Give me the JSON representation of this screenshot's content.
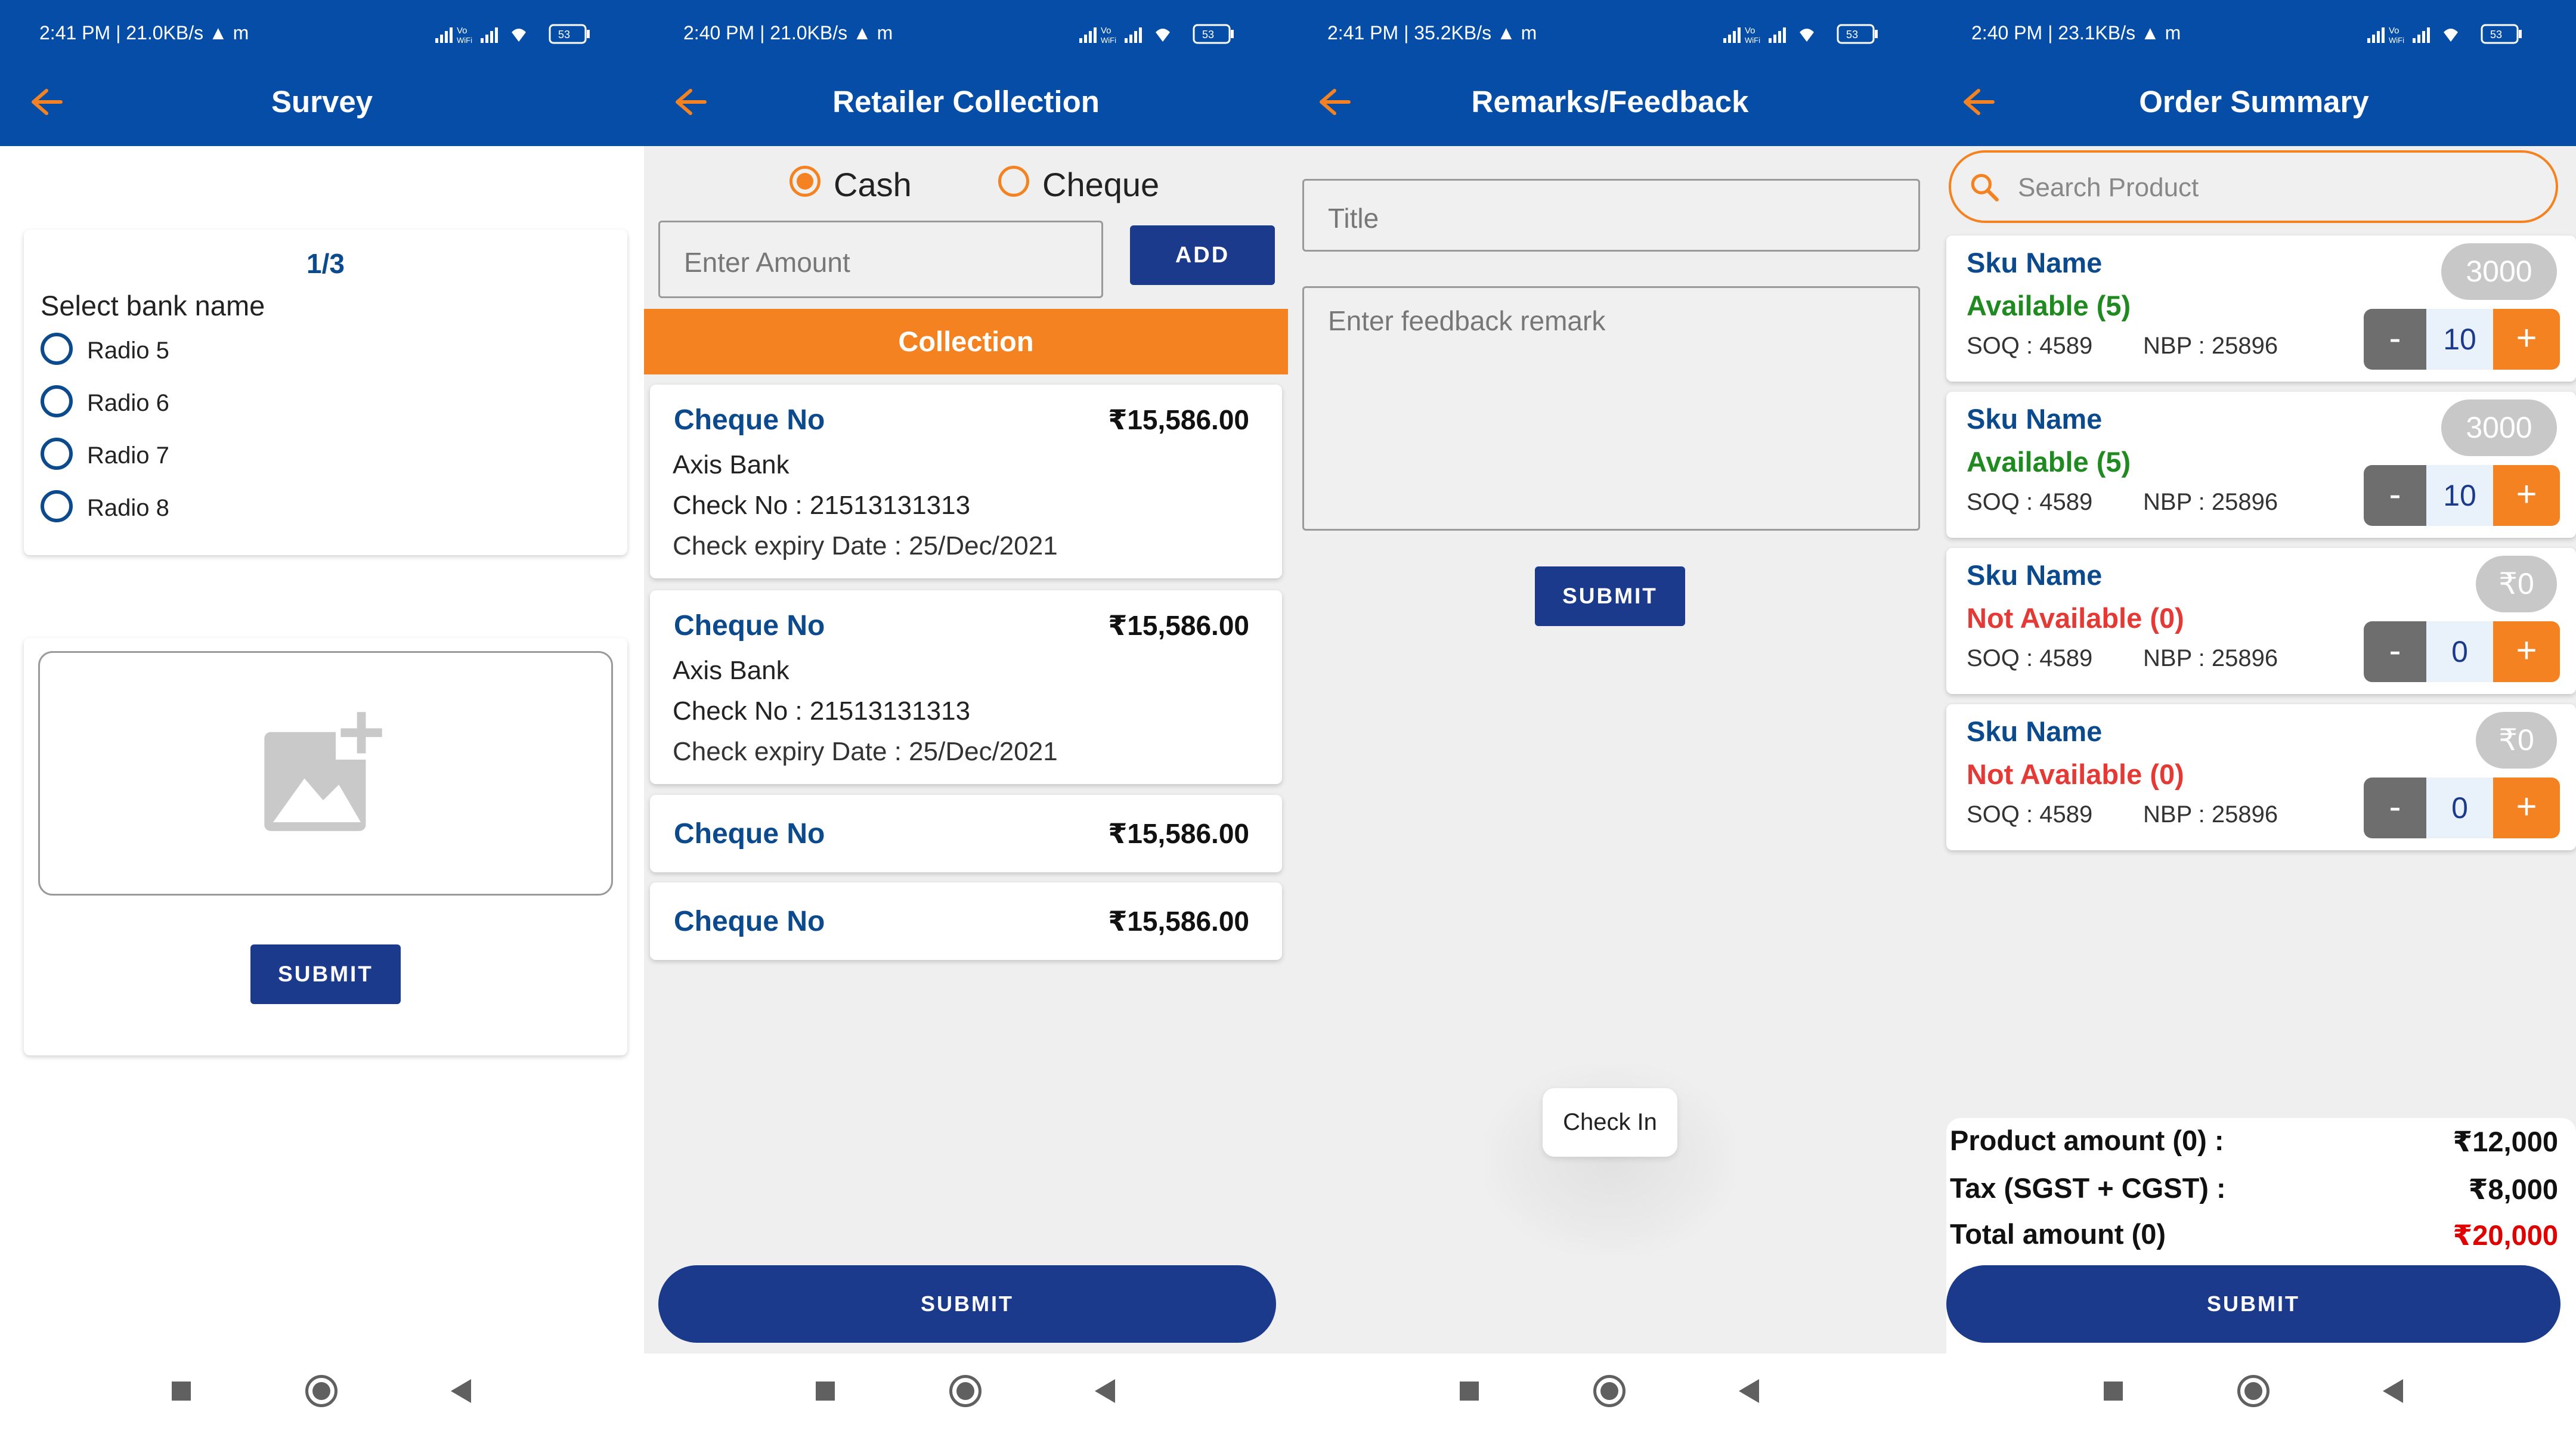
{
  "nav": {
    "square": "recent-apps",
    "circle": "home",
    "triangle": "back"
  },
  "screens": [
    {
      "status": {
        "time": "2:41 PM | 21.0KB/s ▲ m",
        "battery": "53"
      },
      "title": "Survey",
      "question": {
        "counter": "1/3",
        "label": "Select bank name",
        "options": [
          "Radio 5",
          "Radio 6",
          "Radio 7",
          "Radio 8"
        ]
      },
      "image_upload": {
        "icon": "add-photo-icon"
      },
      "submit": "SUBMIT"
    },
    {
      "status": {
        "time": "2:40 PM | 21.0KB/s ▲ m",
        "battery": "53"
      },
      "title": "Retailer Collection",
      "payment_modes": [
        "Cash",
        "Cheque"
      ],
      "selected_mode": "Cash",
      "amount_placeholder": "Enter Amount",
      "add_button": "ADD",
      "collection_header": "Collection",
      "cheques": [
        {
          "title": "Cheque No",
          "amount": "₹15,586.00",
          "bank": "Axis Bank",
          "check_no": "Check No : 21513131313",
          "expiry": "Check expiry Date : 25/Dec/2021"
        },
        {
          "title": "Cheque No",
          "amount": "₹15,586.00",
          "bank": "Axis Bank",
          "check_no": "Check No : 21513131313",
          "expiry": "Check expiry Date : 25/Dec/2021"
        },
        {
          "title": "Cheque No",
          "amount": "₹15,586.00"
        },
        {
          "title": "Cheque No",
          "amount": "₹15,586.00"
        }
      ],
      "submit": "SUBMIT"
    },
    {
      "status": {
        "time": "2:41 PM | 35.2KB/s ▲ m",
        "battery": "53"
      },
      "title": "Remarks/Feedback",
      "title_placeholder": "Title",
      "remark_placeholder": "Enter feedback remark",
      "submit": "SUBMIT",
      "toast": "Check In"
    },
    {
      "status": {
        "time": "2:40 PM | 23.1KB/s ▲ m",
        "battery": "53"
      },
      "title": "Order Summary",
      "search_placeholder": "Search Product",
      "products": [
        {
          "name": "Sku Name",
          "availability": "Available (5)",
          "available": true,
          "soq": "SOQ : 4589",
          "nbp": "NBP : 25896",
          "price": "3000",
          "qty": "10",
          "minus": "-",
          "plus": "+"
        },
        {
          "name": "Sku Name",
          "availability": "Available (5)",
          "available": true,
          "soq": "SOQ : 4589",
          "nbp": "NBP : 25896",
          "price": "3000",
          "qty": "10",
          "minus": "-",
          "plus": "+"
        },
        {
          "name": "Sku Name",
          "availability": "Not Available (0)",
          "available": false,
          "soq": "SOQ : 4589",
          "nbp": "NBP : 25896",
          "price": "₹0",
          "qty": "0",
          "minus": "-",
          "plus": "+"
        },
        {
          "name": "Sku Name",
          "availability": "Not Available (0)",
          "available": false,
          "soq": "SOQ : 4589",
          "nbp": "NBP : 25896",
          "price": "₹0",
          "qty": "0",
          "minus": "-",
          "plus": "+"
        }
      ],
      "totals": {
        "product_label": "Product amount (0) :",
        "product_value": "₹12,000",
        "tax_label": "Tax (SGST + CGST) :",
        "tax_value": "₹8,000",
        "total_label": "Total amount (0)",
        "total_value": "₹20,000"
      },
      "submit": "SUBMIT"
    }
  ],
  "colors": {
    "primary": "#054da7",
    "accent": "#f58220",
    "button": "#1b3a8c",
    "available": "#1f8a1f",
    "unavailable": "#e53935",
    "total": "#e00000"
  }
}
